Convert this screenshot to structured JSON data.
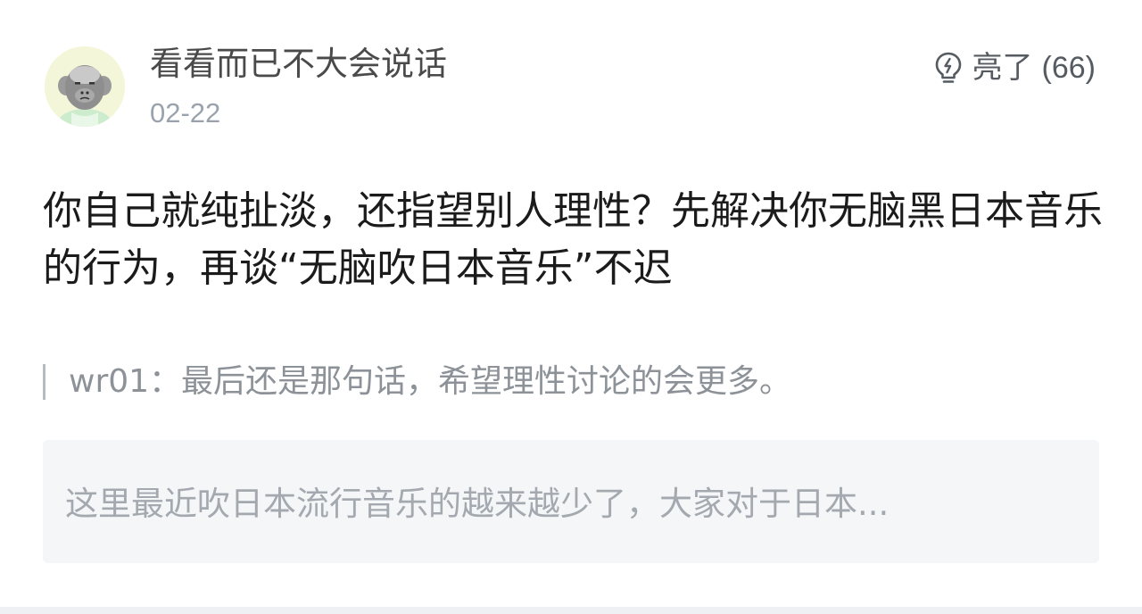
{
  "author": {
    "name": "看看而已不大会说话",
    "date": "02-22",
    "avatar_icon": "cartoon-face-avatar"
  },
  "light": {
    "icon": "lightbulb-icon",
    "label": "亮了",
    "count": "(66)"
  },
  "comment": {
    "text": "你自己就纯扯淡，还指望别人理性？先解决你无脑黑日本音乐的行为，再谈“无脑吹日本音乐”不迟"
  },
  "quote": {
    "text": "wr01：最后还是那句话，希望理性讨论的会更多。"
  },
  "original_post": {
    "snippet": "这里最近吹日本流行音乐的越来越少了，大家对于日本..."
  },
  "colors": {
    "text_primary": "#1b1b1b",
    "text_secondary": "#9aa3ad",
    "card_bg": "#f4f6f8"
  }
}
